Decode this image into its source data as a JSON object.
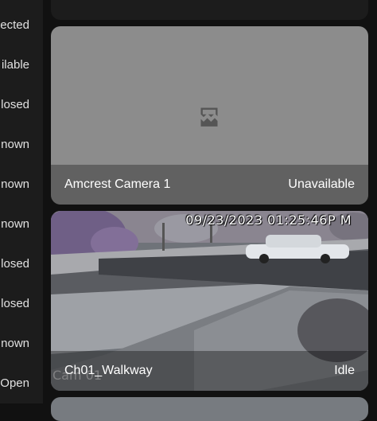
{
  "entity_states": [
    "ected",
    "ilable",
    "losed",
    "nown",
    "nown",
    "nown",
    "losed",
    "losed",
    "nown",
    "Open"
  ],
  "camera_unavailable": {
    "name": "Amcrest Camera 1",
    "state": "Unavailable",
    "icon": "broken-image-icon"
  },
  "camera_walkway": {
    "osd_timestamp": "09/23/2023 01:25:46P M",
    "osd_camera_label": "Cam 01",
    "name": "Ch01_Walkway",
    "state": "Idle"
  },
  "colors": {
    "card_background": "#1c1c1c",
    "unavailable_card": "#8c8c8c",
    "text": "#e1e1e1"
  }
}
